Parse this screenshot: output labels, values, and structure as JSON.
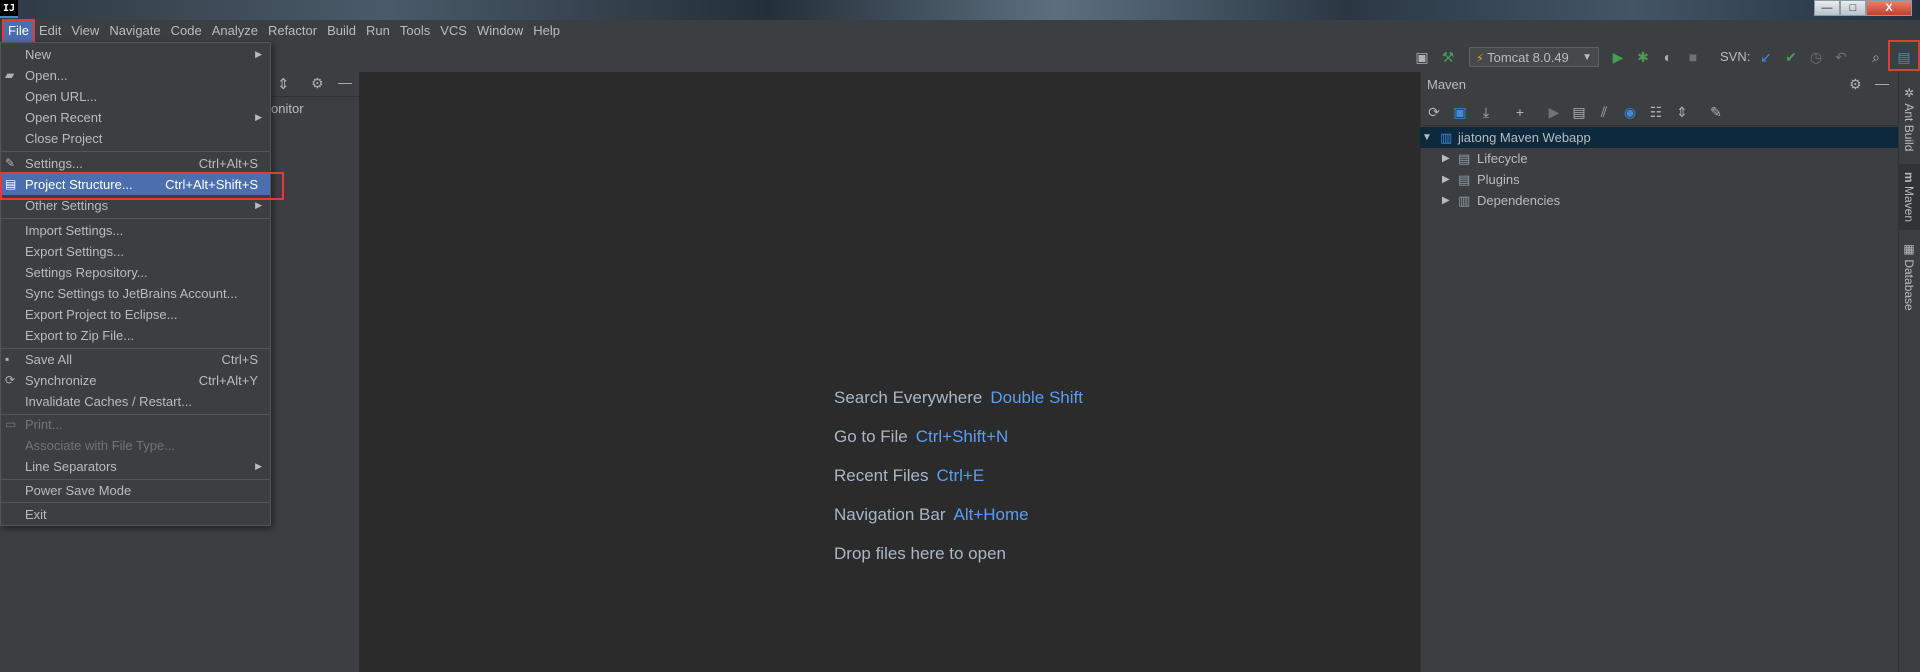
{
  "window": {
    "logo": "IJ",
    "minimize": "—",
    "maximize": "□",
    "close": "X"
  },
  "menubar": {
    "items": [
      "File",
      "Edit",
      "View",
      "Navigate",
      "Code",
      "Analyze",
      "Refactor",
      "Build",
      "Run",
      "Tools",
      "VCS",
      "Window",
      "Help"
    ]
  },
  "toolbar": {
    "run_config": "Tomcat 8.0.49",
    "svn_label": "SVN:"
  },
  "project_panel": {
    "partial_text": "onitor"
  },
  "editor_hints": [
    {
      "text": "Search Everywhere",
      "key": "Double Shift"
    },
    {
      "text": "Go to File",
      "key": "Ctrl+Shift+N"
    },
    {
      "text": "Recent Files",
      "key": "Ctrl+E"
    },
    {
      "text": "Navigation Bar",
      "key": "Alt+Home"
    },
    {
      "text": "Drop files here to open",
      "key": ""
    }
  ],
  "maven": {
    "title": "Maven",
    "root": "jiatong Maven Webapp",
    "children": [
      "Lifecycle",
      "Plugins",
      "Dependencies"
    ]
  },
  "right_tabs": [
    "Ant Build",
    "Maven",
    "Database"
  ],
  "file_menu": {
    "items": [
      {
        "label": "New",
        "shortcut": "",
        "submenu": true
      },
      {
        "label": "Open...",
        "shortcut": ""
      },
      {
        "label": "Open URL...",
        "shortcut": ""
      },
      {
        "label": "Open Recent",
        "shortcut": "",
        "submenu": true
      },
      {
        "label": "Close Project",
        "shortcut": ""
      },
      {
        "label": "Settings...",
        "shortcut": "Ctrl+Alt+S"
      },
      {
        "label": "Project Structure...",
        "shortcut": "Ctrl+Alt+Shift+S"
      },
      {
        "label": "Other Settings",
        "shortcut": "",
        "submenu": true
      },
      {
        "label": "Import Settings...",
        "shortcut": ""
      },
      {
        "label": "Export Settings...",
        "shortcut": ""
      },
      {
        "label": "Settings Repository...",
        "shortcut": ""
      },
      {
        "label": "Sync Settings to JetBrains Account...",
        "shortcut": ""
      },
      {
        "label": "Export Project to Eclipse...",
        "shortcut": ""
      },
      {
        "label": "Export to Zip File...",
        "shortcut": ""
      },
      {
        "label": "Save All",
        "shortcut": "Ctrl+S"
      },
      {
        "label": "Synchronize",
        "shortcut": "Ctrl+Alt+Y"
      },
      {
        "label": "Invalidate Caches / Restart...",
        "shortcut": ""
      },
      {
        "label": "Print...",
        "shortcut": "",
        "disabled": true
      },
      {
        "label": "Associate with File Type...",
        "shortcut": "",
        "disabled": true
      },
      {
        "label": "Line Separators",
        "shortcut": "",
        "submenu": true
      },
      {
        "label": "Power Save Mode",
        "shortcut": ""
      },
      {
        "label": "Exit",
        "shortcut": ""
      }
    ]
  },
  "colors": {
    "highlight": "#4b6eaf",
    "annotation": "#e03c3c",
    "key_blue": "#589df6",
    "run_green": "#499c54"
  }
}
